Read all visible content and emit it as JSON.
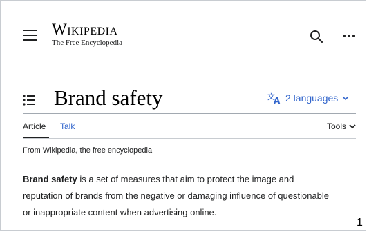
{
  "header": {
    "wordmark": "Wikipedia",
    "tagline": "The Free Encyclopedia",
    "icons": [
      "menu-icon",
      "search-icon",
      "more-options-icon"
    ]
  },
  "article": {
    "title": "Brand safety",
    "languages_label": "2 languages",
    "tabs": [
      {
        "label": "Article",
        "selected": true
      },
      {
        "label": "Talk",
        "selected": false
      }
    ],
    "tools_label": "Tools",
    "from_wikipedia": "From Wikipedia, the free encyclopedia",
    "lead_bold": "Brand safety",
    "lead_rest": " is a set of measures that aim to protect the image and reputation of brands from the negative or damaging influence of questionable or inappropriate content when advertising online."
  },
  "page_number": "1",
  "colors": {
    "link": "#3366cc",
    "text": "#202122",
    "rule": "#a2a9b1"
  }
}
